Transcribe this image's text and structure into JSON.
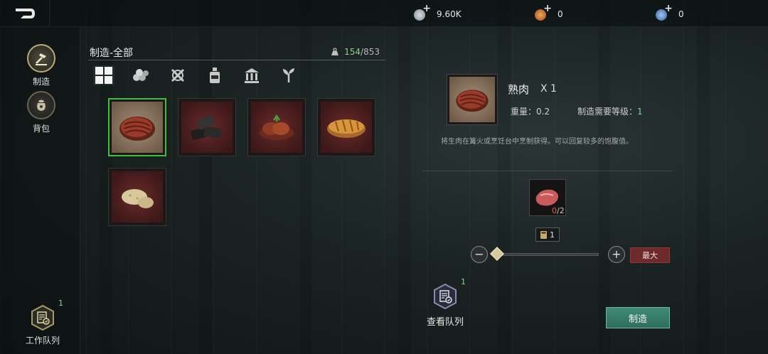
{
  "topbar": {
    "currencies": [
      {
        "icon": "silver-coin-icon",
        "value": "9.60K",
        "color": "#9aa6b0"
      },
      {
        "icon": "gold-medal-icon",
        "value": "0",
        "color": "#d9822b"
      },
      {
        "icon": "blue-gem-icon",
        "value": "0",
        "color": "#5a8fd0"
      }
    ]
  },
  "sidebar": {
    "items": [
      {
        "label": "制造",
        "icon": "crafting-hammer-icon",
        "active": true
      },
      {
        "label": "背包",
        "icon": "backpack-bag-icon",
        "active": false
      }
    ],
    "work_queue": {
      "label": "工作队列",
      "badge": "1",
      "icon": "queue-list-icon"
    }
  },
  "crafting": {
    "title": "制造-全部",
    "count_current": "154",
    "count_sep": "/",
    "count_total": "853",
    "count_icon": "weight-icon",
    "tabs": [
      {
        "name": "all",
        "icon": "grid-all-icon",
        "active": true
      },
      {
        "name": "materials",
        "icon": "logs-icon",
        "active": false
      },
      {
        "name": "tools",
        "icon": "tools-icon",
        "active": false
      },
      {
        "name": "consumables",
        "icon": "bottle-icon",
        "active": false
      },
      {
        "name": "buildings",
        "icon": "building-icon",
        "active": false
      },
      {
        "name": "special",
        "icon": "plant-icon",
        "active": false
      }
    ],
    "items": [
      {
        "icon": "cooked-meat-icon",
        "selected": true
      },
      {
        "icon": "charcoal-icon",
        "selected": false
      },
      {
        "icon": "grilled-meat-icon",
        "selected": false
      },
      {
        "icon": "bread-icon",
        "selected": false
      },
      {
        "icon": "potato-icon",
        "selected": false
      }
    ]
  },
  "detail": {
    "name": "熟肉",
    "qty": "X 1",
    "weight_label": "重量：",
    "weight_value": "0.2",
    "level_label": "制造需要等级：",
    "level_value": "1",
    "description": "将生肉在篝火或烹饪台中烹制获得。可以回复较多的饱腹值。",
    "material": {
      "icon": "raw-meat-icon",
      "have": "0",
      "need": "/2"
    },
    "quantity": "1",
    "quantity_fraction": 0,
    "max_label": "最大",
    "queue_label": "查看队列",
    "queue_badge": "1",
    "craft_label": "制造"
  }
}
